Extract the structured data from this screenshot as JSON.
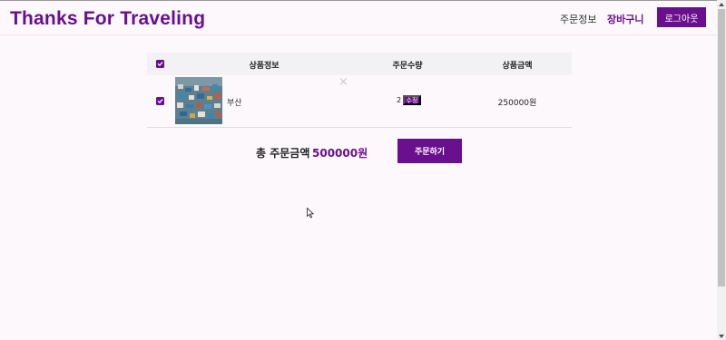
{
  "header": {
    "logo": "Thanks For Traveling",
    "nav": {
      "orders": "주문정보",
      "cart": "장바구니"
    },
    "logout_label": "로그아웃"
  },
  "cart_table": {
    "columns": [
      "상품정보",
      "주문수량",
      "상품금액"
    ],
    "rows": [
      {
        "checked": true,
        "name": "부산",
        "quantity": "2",
        "edit_label": "수정",
        "price": "250000원",
        "remove_icon": "×"
      }
    ],
    "select_all_checked": true
  },
  "summary": {
    "total_label": "총 주문금액",
    "total_value": "500000원",
    "order_label": "주문하기"
  },
  "colors": {
    "accent": "#6a0f8e",
    "background": "#fcf8fc",
    "header_row": "#f3f1f3"
  },
  "icons": [
    "checkbox-check-icon",
    "remove-x-icon",
    "scroll-up-arrow-icon",
    "scroll-down-arrow-icon",
    "mouse-cursor-icon"
  ]
}
